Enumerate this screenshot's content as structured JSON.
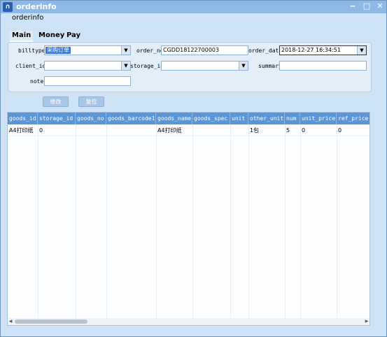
{
  "window": {
    "title": "orderinfo",
    "app_icon": "app-logo-icon",
    "controls": {
      "minimize": "‒",
      "maximize": "□",
      "close": "✕"
    }
  },
  "panel_title": "orderinfo",
  "tabs": [
    {
      "label": "Main",
      "active": true
    },
    {
      "label": "Money",
      "active": false
    },
    {
      "label": "Pay",
      "active": false
    }
  ],
  "form": {
    "billtype": {
      "label": "billtype",
      "value": "采购订单"
    },
    "order_no": {
      "label": "order_no",
      "value": "CGDD18122700003"
    },
    "order_date": {
      "label": "order_date",
      "value": "2018-12-27 16:34:51"
    },
    "client_id": {
      "label": "client_id",
      "value": ""
    },
    "storage_id": {
      "label": "storage_id",
      "value": ""
    },
    "summary": {
      "label": "summary",
      "value": ""
    },
    "note": {
      "label": "note",
      "value": ""
    }
  },
  "buttons": {
    "modify": "修改",
    "reset": "复位"
  },
  "grid": {
    "columns": [
      "goods_id",
      "storage_id",
      "goods_no",
      "goods_barcode1",
      "goods_name",
      "goods_spec",
      "unit",
      "other_unit",
      "num",
      "unit_price",
      "ref_price"
    ],
    "rows": [
      [
        "A4打印纸",
        "0",
        "",
        "",
        "A4打印纸",
        "",
        "",
        "1包",
        "5",
        "0",
        "0"
      ]
    ]
  },
  "colors": {
    "header": "#5b95d6",
    "selection": "#3b78d8",
    "background": "#cfe3f7"
  }
}
